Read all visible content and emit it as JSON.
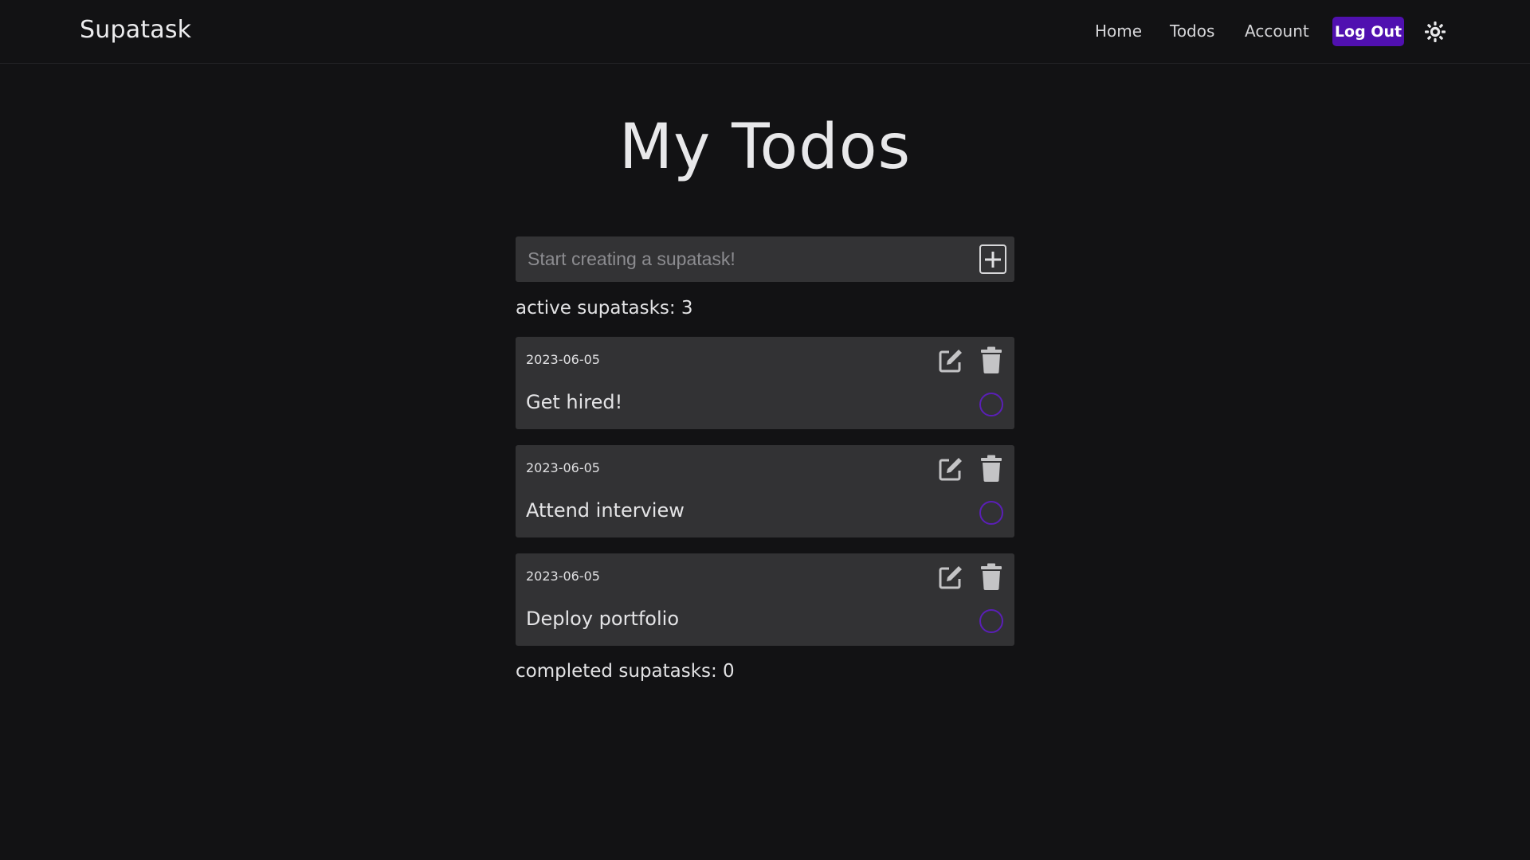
{
  "app": {
    "brand": "Supatask"
  },
  "nav": {
    "links": [
      "Home",
      "Todos",
      "Account"
    ],
    "logout_label": "Log Out",
    "theme_icon": "sun-icon"
  },
  "main": {
    "title": "My Todos",
    "new_todo": {
      "placeholder": "Start creating a supatask!",
      "add_icon": "plus-square-icon"
    },
    "active_label": "active supatasks: 3",
    "todos": [
      {
        "date": "2023-06-05",
        "text": "Get hired!",
        "completed": false
      },
      {
        "date": "2023-06-05",
        "text": "Attend interview",
        "completed": false
      },
      {
        "date": "2023-06-05",
        "text": "Deploy portfolio",
        "completed": false
      }
    ],
    "completed_label": "completed supatasks: 0"
  },
  "colors": {
    "background": "#121214",
    "card": "#323234",
    "accent": "#5010b0",
    "check_ring": "#5a1fb6"
  }
}
